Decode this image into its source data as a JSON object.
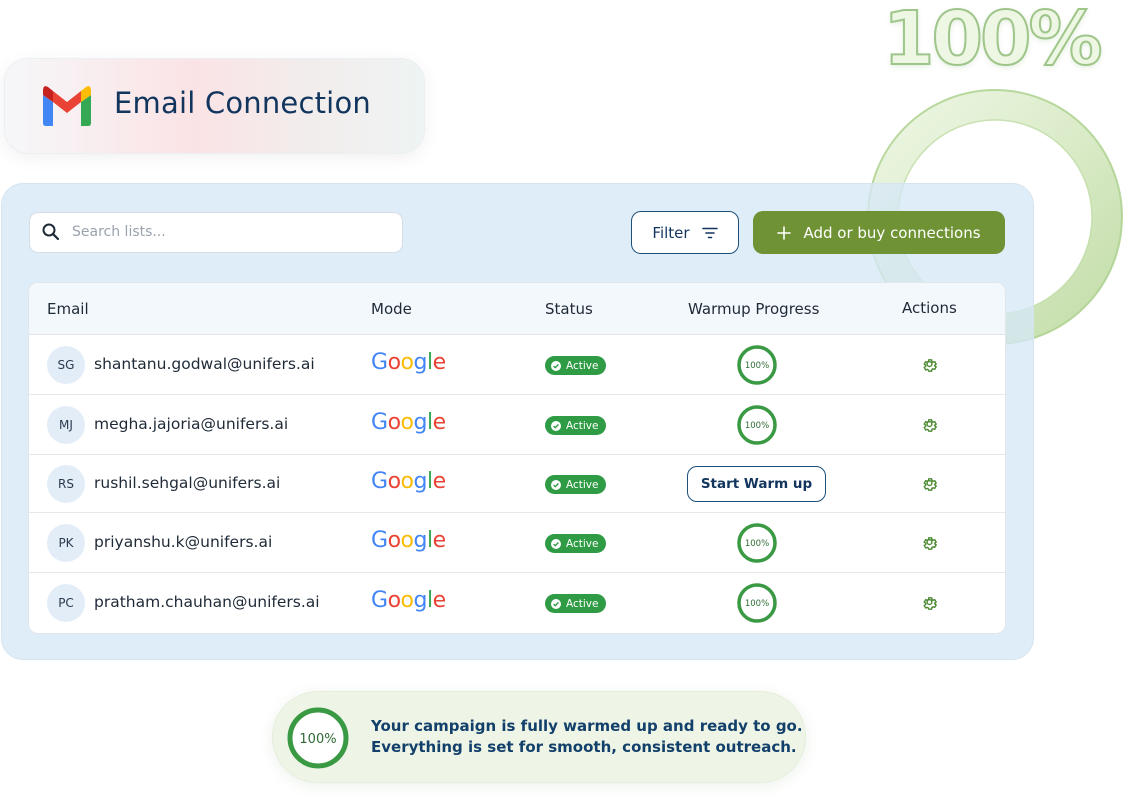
{
  "header": {
    "title": "Email Connection",
    "icon": "gmail-icon"
  },
  "decor": {
    "big_percent": "100%"
  },
  "toolbar": {
    "search_placeholder": "Search lists...",
    "filter_label": "Filter",
    "add_label": "Add or buy connections"
  },
  "table": {
    "headers": {
      "email": "Email",
      "mode": "Mode",
      "status": "Status",
      "warmup": "Warmup Progress",
      "actions": "Actions"
    },
    "rows": [
      {
        "initials": "SG",
        "email": "shantanu.godwal@unifers.ai",
        "mode": "Google",
        "status": "Active",
        "progress": 100,
        "progress_label": "100%"
      },
      {
        "initials": "MJ",
        "email": "megha.jajoria@unifers.ai",
        "mode": "Google",
        "status": "Active",
        "progress": 100,
        "progress_label": "100%"
      },
      {
        "initials": "RS",
        "email": "rushil.sehgal@unifers.ai",
        "mode": "Google",
        "status": "Active",
        "action_label": "Start Warm up"
      },
      {
        "initials": "PK",
        "email": "priyanshu.k@unifers.ai",
        "mode": "Google",
        "status": "Active",
        "progress": 100,
        "progress_label": "100%"
      },
      {
        "initials": "PC",
        "email": "pratham.chauhan@unifers.ai",
        "mode": "Google",
        "status": "Active",
        "progress": 100,
        "progress_label": "100%"
      }
    ]
  },
  "toast": {
    "progress": 100,
    "progress_label": "100%",
    "line1": "Your campaign is fully warmed up and ready to go.",
    "line2": "Everything is set for smooth, consistent outreach."
  },
  "colors": {
    "accent": "#6f9334",
    "navy": "#12355e",
    "active": "#2f9b44",
    "ring": "#3a9a44"
  }
}
